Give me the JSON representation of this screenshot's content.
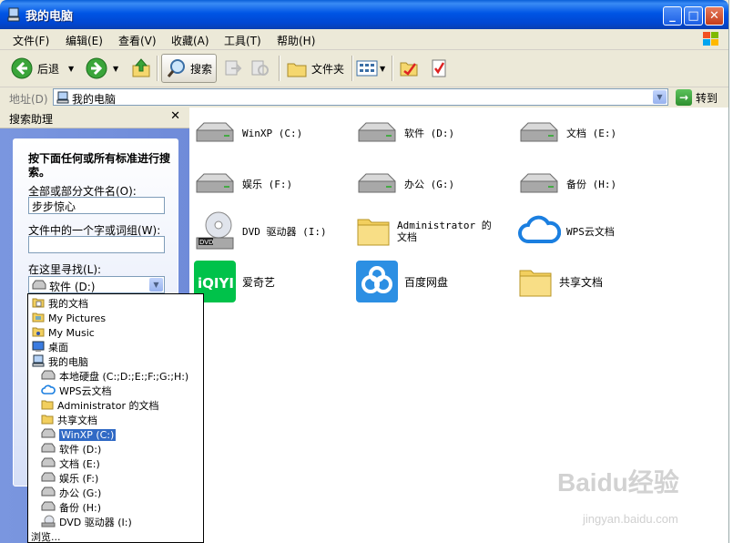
{
  "window": {
    "title": "我的电脑"
  },
  "menu": [
    "文件(F)",
    "编辑(E)",
    "查看(V)",
    "收藏(A)",
    "工具(T)",
    "帮助(H)"
  ],
  "toolbar": {
    "back_label": "后退",
    "search_label": "搜索",
    "folders_label": "文件夹"
  },
  "address": {
    "label": "地址(D)",
    "value": "我的电脑",
    "go_label": "转到"
  },
  "search_pane": {
    "title": "搜索助理",
    "hint": "按下面任何或所有标准进行搜索。",
    "filename_label": "全部或部分文件名(O):",
    "filename_value": "步步惊心",
    "phrase_label": "文件中的一个字或词组(W):",
    "phrase_value": "",
    "lookin_label": "在这里寻找(L):",
    "lookin_value": "软件 (D:)"
  },
  "lookin_options": [
    {
      "label": "我的文档",
      "icon": "folder-docs-icon",
      "indent": 0
    },
    {
      "label": "My Pictures",
      "icon": "folder-pictures-icon",
      "indent": 0
    },
    {
      "label": "My Music",
      "icon": "folder-music-icon",
      "indent": 0
    },
    {
      "label": "桌面",
      "icon": "desktop-icon",
      "indent": 0
    },
    {
      "label": "我的电脑",
      "icon": "computer-icon",
      "indent": 0
    },
    {
      "label": "本地硬盘 (C:;D:;E:;F:;G:;H:)",
      "icon": "drive-icon",
      "indent": 1
    },
    {
      "label": "WPS云文档",
      "icon": "cloud-icon",
      "indent": 1
    },
    {
      "label": "Administrator 的文档",
      "icon": "folder-icon",
      "indent": 1
    },
    {
      "label": "共享文档",
      "icon": "folder-icon",
      "indent": 1
    },
    {
      "label": "WinXP (C:)",
      "icon": "drive-icon",
      "indent": 1,
      "selected": true
    },
    {
      "label": "软件 (D:)",
      "icon": "drive-icon",
      "indent": 1
    },
    {
      "label": "文档 (E:)",
      "icon": "drive-icon",
      "indent": 1
    },
    {
      "label": "娱乐 (F:)",
      "icon": "drive-icon",
      "indent": 1
    },
    {
      "label": "办公 (G:)",
      "icon": "drive-icon",
      "indent": 1
    },
    {
      "label": "备份 (H:)",
      "icon": "drive-icon",
      "indent": 1
    },
    {
      "label": "DVD 驱动器 (I:)",
      "icon": "dvd-icon",
      "indent": 1
    },
    {
      "label": "浏览...",
      "icon": "",
      "indent": -1
    }
  ],
  "items": [
    {
      "label": "WinXP (C:)",
      "icon": "drive"
    },
    {
      "label": "软件 (D:)",
      "icon": "drive"
    },
    {
      "label": "文档 (E:)",
      "icon": "drive"
    },
    {
      "label": "娱乐 (F:)",
      "icon": "drive"
    },
    {
      "label": "办公 (G:)",
      "icon": "drive"
    },
    {
      "label": "备份 (H:)",
      "icon": "drive"
    },
    {
      "label": "DVD 驱动器 (I:)",
      "icon": "dvd"
    },
    {
      "label": "Administrator 的文档",
      "icon": "folder"
    },
    {
      "label": "WPS云文档",
      "icon": "cloud"
    },
    {
      "label": "爱奇艺",
      "icon": "iqiyi"
    },
    {
      "label": "百度网盘",
      "icon": "baidu"
    },
    {
      "label": "共享文档",
      "icon": "folder"
    }
  ],
  "watermark": {
    "main": "Baidu经验",
    "sub": "jingyan.baidu.com"
  }
}
